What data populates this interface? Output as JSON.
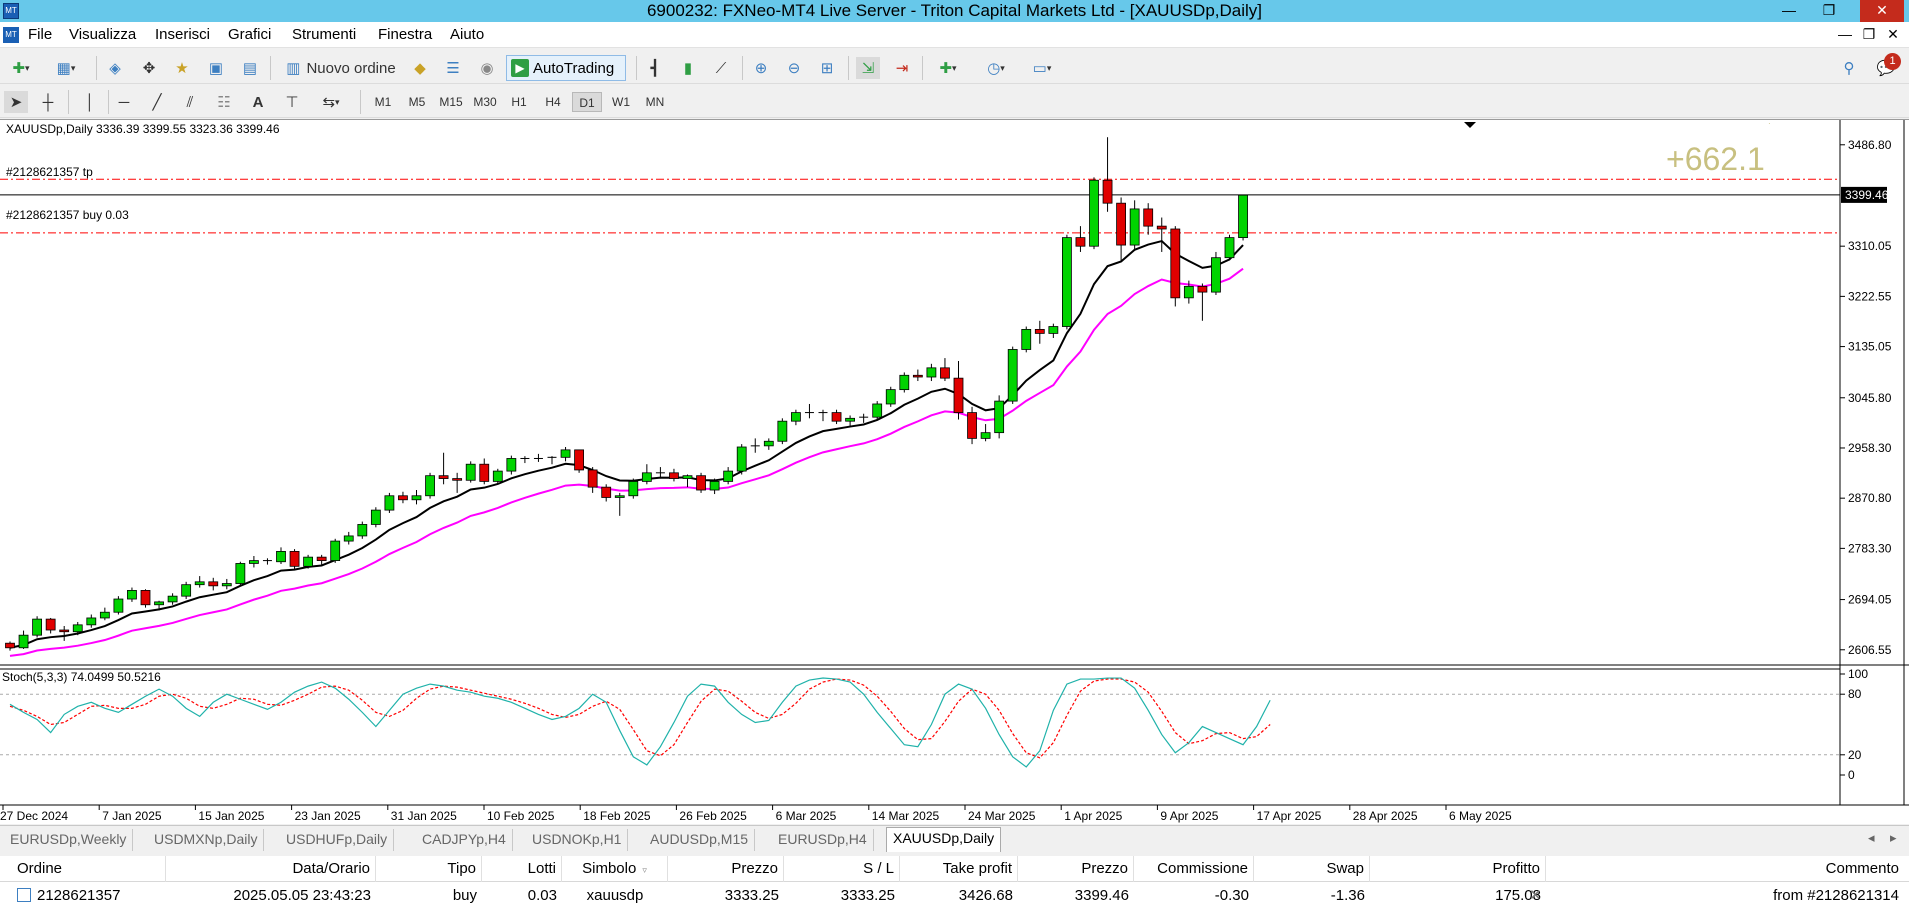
{
  "window": {
    "title": "6900232: FXNeo-MT4 Live Server - Triton Capital Markets Ltd - [XAUUSDp,Daily]"
  },
  "menu": {
    "items": [
      "File",
      "Visualizza",
      "Inserisci",
      "Grafici",
      "Strumenti",
      "Finestra",
      "Aiuto"
    ]
  },
  "toolbar": {
    "new_order_label": "Nuovo ordine",
    "autotrading_label": "AutoTrading",
    "timeframes": [
      "M1",
      "M5",
      "M15",
      "M30",
      "H1",
      "H4",
      "D1",
      "W1",
      "MN"
    ],
    "active_timeframe": "D1",
    "notification_count": "1"
  },
  "chart": {
    "symbol_line": "XAUUSDp,Daily  3336.39 3399.55 3323.36 3399.46",
    "tp_label": "#2128621357 tp",
    "buy_label": "#2128621357 buy 0.03",
    "profit_points": "+662.1",
    "current_price": "3399.46",
    "price_ticks": [
      "3486.80",
      "3310.05",
      "3222.55",
      "3135.05",
      "3045.80",
      "2958.30",
      "2870.80",
      "2783.30",
      "2694.05",
      "2606.55"
    ],
    "date_ticks": [
      "27 Dec 2024",
      "7 Jan 2025",
      "15 Jan 2025",
      "23 Jan 2025",
      "31 Jan 2025",
      "10 Feb 2025",
      "18 Feb 2025",
      "26 Feb 2025",
      "6 Mar 2025",
      "14 Mar 2025",
      "24 Mar 2025",
      "1 Apr 2025",
      "9 Apr 2025",
      "17 Apr 2025",
      "28 Apr 2025",
      "6 May 2025"
    ],
    "stoch_label": "Stoch(5,3,3) 74.0499 50.5216",
    "stoch_ticks": [
      "100",
      "80",
      "20",
      "0"
    ],
    "colors": {
      "bull": "#00d400",
      "bear": "#e00000",
      "ma_fast": "#000000",
      "ma_slow": "#ff00ff",
      "stoch_main": "#20b2aa",
      "stoch_signal": "#ff0000",
      "order_line": "#ff0000",
      "profit_text": "#c8c080"
    }
  },
  "chart_data": {
    "type": "candlestick",
    "symbol": "XAUUSDp",
    "timeframe": "Daily",
    "ylim": [
      2580,
      3530
    ],
    "tp_price": 3426.68,
    "entry_price": 3333.25,
    "candles": [
      [
        2618,
        2621,
        2605,
        2610
      ],
      [
        2610,
        2640,
        2608,
        2632
      ],
      [
        2632,
        2665,
        2628,
        2660
      ],
      [
        2660,
        2662,
        2635,
        2641
      ],
      [
        2641,
        2648,
        2622,
        2638
      ],
      [
        2638,
        2655,
        2632,
        2650
      ],
      [
        2650,
        2668,
        2645,
        2662
      ],
      [
        2662,
        2680,
        2658,
        2672
      ],
      [
        2672,
        2700,
        2668,
        2695
      ],
      [
        2695,
        2715,
        2690,
        2710
      ],
      [
        2710,
        2712,
        2680,
        2685
      ],
      [
        2685,
        2692,
        2675,
        2690
      ],
      [
        2690,
        2705,
        2685,
        2700
      ],
      [
        2700,
        2725,
        2695,
        2720
      ],
      [
        2720,
        2735,
        2715,
        2725
      ],
      [
        2725,
        2732,
        2710,
        2718
      ],
      [
        2718,
        2730,
        2712,
        2722
      ],
      [
        2722,
        2760,
        2718,
        2757
      ],
      [
        2757,
        2770,
        2750,
        2762
      ],
      [
        2762,
        2766,
        2755,
        2760
      ],
      [
        2760,
        2785,
        2756,
        2778
      ],
      [
        2778,
        2782,
        2745,
        2752
      ],
      [
        2752,
        2772,
        2748,
        2768
      ],
      [
        2768,
        2772,
        2755,
        2762
      ],
      [
        2762,
        2800,
        2758,
        2796
      ],
      [
        2796,
        2812,
        2790,
        2805
      ],
      [
        2805,
        2830,
        2800,
        2825
      ],
      [
        2825,
        2855,
        2820,
        2850
      ],
      [
        2850,
        2880,
        2845,
        2875
      ],
      [
        2875,
        2882,
        2862,
        2868
      ],
      [
        2868,
        2885,
        2860,
        2875
      ],
      [
        2875,
        2915,
        2870,
        2910
      ],
      [
        2910,
        2950,
        2895,
        2905
      ],
      [
        2905,
        2915,
        2880,
        2902
      ],
      [
        2902,
        2935,
        2898,
        2930
      ],
      [
        2930,
        2940,
        2895,
        2900
      ],
      [
        2900,
        2922,
        2895,
        2918
      ],
      [
        2918,
        2945,
        2912,
        2940
      ],
      [
        2940,
        2944,
        2932,
        2938
      ],
      [
        2938,
        2948,
        2934,
        2940
      ],
      [
        2940,
        2944,
        2930,
        2942
      ],
      [
        2942,
        2960,
        2935,
        2955
      ],
      [
        2955,
        2955,
        2915,
        2920
      ],
      [
        2920,
        2925,
        2880,
        2890
      ],
      [
        2890,
        2895,
        2865,
        2872
      ],
      [
        2872,
        2880,
        2840,
        2875
      ],
      [
        2875,
        2905,
        2870,
        2900
      ],
      [
        2900,
        2930,
        2895,
        2915
      ],
      [
        2915,
        2925,
        2905,
        2915
      ],
      [
        2915,
        2922,
        2900,
        2905
      ],
      [
        2905,
        2912,
        2890,
        2910
      ],
      [
        2910,
        2915,
        2880,
        2885
      ],
      [
        2885,
        2905,
        2878,
        2900
      ],
      [
        2900,
        2925,
        2895,
        2918
      ],
      [
        2918,
        2965,
        2912,
        2960
      ],
      [
        2960,
        2975,
        2950,
        2962
      ],
      [
        2962,
        2975,
        2955,
        2970
      ],
      [
        2970,
        3010,
        2965,
        3005
      ],
      [
        3005,
        3025,
        2998,
        3020
      ],
      [
        3020,
        3035,
        3010,
        3018
      ],
      [
        3018,
        3025,
        3005,
        3020
      ],
      [
        3020,
        3025,
        3000,
        3005
      ],
      [
        3005,
        3015,
        2995,
        3010
      ],
      [
        3010,
        3018,
        3002,
        3012
      ],
      [
        3012,
        3040,
        3008,
        3035
      ],
      [
        3035,
        3065,
        3030,
        3060
      ],
      [
        3060,
        3090,
        3055,
        3085
      ],
      [
        3085,
        3095,
        3075,
        3082
      ],
      [
        3082,
        3105,
        3075,
        3098
      ],
      [
        3098,
        3115,
        3075,
        3080
      ],
      [
        3080,
        3110,
        3008,
        3020
      ],
      [
        3020,
        3030,
        2965,
        2975
      ],
      [
        2975,
        3000,
        2970,
        2985
      ],
      [
        2985,
        3050,
        2975,
        3040
      ],
      [
        3040,
        3135,
        3035,
        3130
      ],
      [
        3130,
        3170,
        3125,
        3165
      ],
      [
        3165,
        3180,
        3140,
        3158
      ],
      [
        3158,
        3175,
        3150,
        3170
      ],
      [
        3170,
        3330,
        3165,
        3325
      ],
      [
        3325,
        3345,
        3300,
        3310
      ],
      [
        3310,
        3430,
        3305,
        3425
      ],
      [
        3425,
        3500,
        3370,
        3385
      ],
      [
        3385,
        3395,
        3285,
        3312
      ],
      [
        3312,
        3390,
        3305,
        3375
      ],
      [
        3375,
        3385,
        3330,
        3345
      ],
      [
        3345,
        3360,
        3300,
        3340
      ],
      [
        3340,
        3345,
        3205,
        3220
      ],
      [
        3220,
        3250,
        3210,
        3240
      ],
      [
        3240,
        3245,
        3180,
        3230
      ],
      [
        3230,
        3300,
        3225,
        3290
      ],
      [
        3290,
        3330,
        3285,
        3325
      ],
      [
        3325,
        3400,
        3320,
        3399
      ]
    ],
    "stoch_main": [
      70,
      62,
      55,
      42,
      60,
      68,
      72,
      66,
      62,
      70,
      78,
      85,
      78,
      66,
      58,
      72,
      80,
      75,
      70,
      65,
      72,
      82,
      88,
      92,
      86,
      75,
      62,
      48,
      64,
      80,
      86,
      90,
      88,
      84,
      82,
      78,
      76,
      72,
      66,
      60,
      55,
      58,
      66,
      80,
      72,
      44,
      18,
      10,
      28,
      52,
      78,
      90,
      88,
      72,
      60,
      52,
      54,
      72,
      88,
      94,
      96,
      95,
      92,
      80,
      62,
      46,
      30,
      28,
      50,
      80,
      90,
      85,
      66,
      40,
      18,
      8,
      24,
      64,
      90,
      95,
      95,
      96,
      96,
      86,
      64,
      40,
      22,
      32,
      48,
      42,
      36,
      30,
      48,
      74
    ],
    "stoch_signal": [
      68,
      64,
      58,
      50,
      52,
      60,
      68,
      69,
      66,
      66,
      70,
      78,
      80,
      76,
      68,
      66,
      70,
      76,
      75,
      70,
      69,
      74,
      80,
      87,
      88,
      84,
      74,
      62,
      58,
      64,
      76,
      85,
      88,
      87,
      84,
      81,
      78,
      75,
      71,
      66,
      60,
      57,
      60,
      68,
      73,
      65,
      45,
      24,
      19,
      30,
      52,
      73,
      85,
      83,
      73,
      62,
      56,
      60,
      71,
      85,
      92,
      95,
      94,
      89,
      78,
      63,
      46,
      35,
      36,
      53,
      73,
      85,
      80,
      64,
      41,
      22,
      17,
      32,
      59,
      83,
      93,
      95,
      95,
      92,
      82,
      63,
      42,
      31,
      34,
      41,
      42,
      36,
      38,
      50
    ]
  },
  "tabs": {
    "items": [
      "EURUSDp,Weekly",
      "USDMXNp,Daily",
      "USDHUFp,Daily",
      "CADJPYp,H4",
      "USDNOKp,H1",
      "AUDUSDp,M15",
      "EURUSDp,H4",
      "XAUUSDp,Daily"
    ],
    "active": "XAUUSDp,Daily"
  },
  "orders": {
    "headers": [
      "Ordine",
      "Data/Orario",
      "Tipo",
      "Lotti",
      "Simbolo",
      "Prezzo",
      "S / L",
      "Take profit",
      "Prezzo",
      "Commissione",
      "Swap",
      "Profitto",
      "Commento"
    ],
    "rows": [
      {
        "ticket": "2128621357",
        "time": "2025.05.05 23:43:23",
        "type": "buy",
        "lots": "0.03",
        "symbol": "xauusdp",
        "price": "3333.25",
        "sl": "3333.25",
        "tp": "3426.68",
        "current": "3399.46",
        "commission": "-0.30",
        "swap": "-1.36",
        "profit": "175.08",
        "comment": "from #2128621314"
      }
    ]
  }
}
